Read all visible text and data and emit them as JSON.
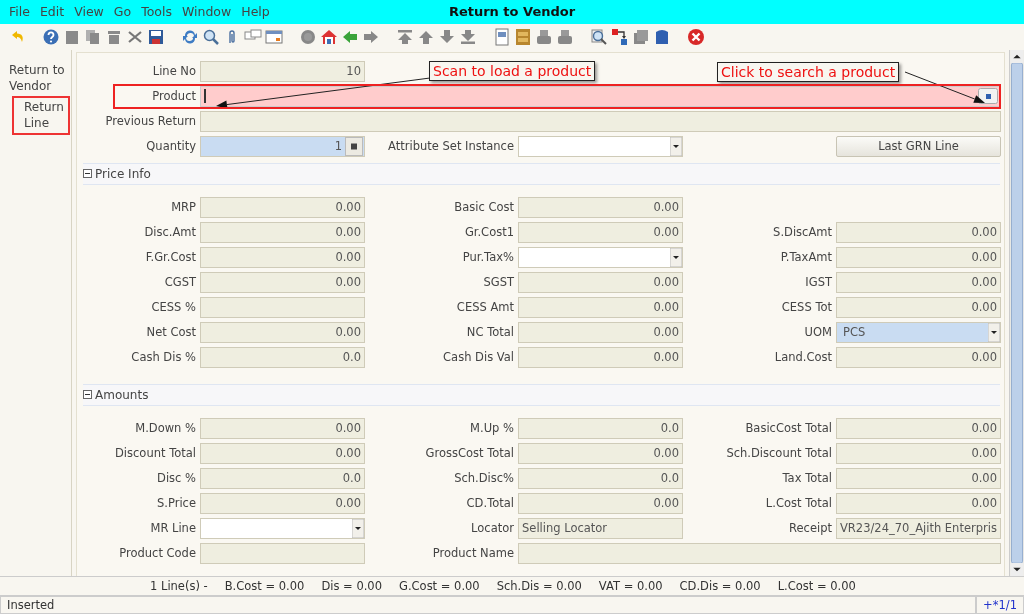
{
  "menu": [
    {
      "label": "File"
    },
    {
      "label": "Edit"
    },
    {
      "label": "View"
    },
    {
      "label": "Go"
    },
    {
      "label": "Tools"
    },
    {
      "label": "Window"
    },
    {
      "label": "Help"
    }
  ],
  "window": {
    "title": "Return to Vendor"
  },
  "tabs": [
    {
      "label": "Return to Vendor",
      "selected": false
    },
    {
      "label": "Return Line",
      "selected": true
    }
  ],
  "header_rows": [
    [
      {
        "label": "Line No",
        "value": "10",
        "kind": "number"
      }
    ],
    [
      {
        "label": "Product",
        "kind": "product",
        "highlighted": true
      }
    ],
    [
      {
        "label": "Previous Return",
        "kind": "wide-text"
      }
    ],
    [
      {
        "label": "Quantity",
        "value": "1",
        "kind": "quantity"
      },
      {
        "label": "Attribute Set Instance",
        "kind": "combo"
      },
      {
        "value": "Last GRN Line",
        "kind": "button"
      }
    ]
  ],
  "sections": [
    {
      "title": "Price Info",
      "expanded": true,
      "rows": [
        [
          {
            "label": "MRP",
            "value": "0.00",
            "kind": "number"
          },
          {
            "label": "Basic Cost",
            "value": "0.00",
            "kind": "number"
          }
        ],
        [
          {
            "label": "Disc.Amt",
            "value": "0.00",
            "kind": "number"
          },
          {
            "label": "Gr.Cost1",
            "value": "0.00",
            "kind": "number"
          },
          {
            "label": "S.DiscAmt",
            "value": "0.00",
            "kind": "number"
          }
        ],
        [
          {
            "label": "F.Gr.Cost",
            "value": "0.00",
            "kind": "number"
          },
          {
            "label": "Pur.Tax%",
            "kind": "combo"
          },
          {
            "label": "P.TaxAmt",
            "value": "0.00",
            "kind": "number"
          }
        ],
        [
          {
            "label": "CGST",
            "value": "0.00",
            "kind": "number"
          },
          {
            "label": "SGST",
            "value": "0.00",
            "kind": "number"
          },
          {
            "label": "IGST",
            "value": "0.00",
            "kind": "number"
          }
        ],
        [
          {
            "label": "CESS %",
            "kind": "number"
          },
          {
            "label": "CESS Amt",
            "value": "0.00",
            "kind": "number"
          },
          {
            "label": "CESS Tot",
            "value": "0.00",
            "kind": "number"
          }
        ],
        [
          {
            "label": "Net Cost",
            "value": "0.00",
            "kind": "number"
          },
          {
            "label": "NC Total",
            "value": "0.00",
            "kind": "number"
          },
          {
            "label": "UOM",
            "value": "PCS",
            "kind": "combo-blue"
          }
        ],
        [
          {
            "label": "Cash Dis %",
            "value": "0.0",
            "kind": "number"
          },
          {
            "label": "Cash Dis Val",
            "value": "0.00",
            "kind": "number"
          },
          {
            "label": "Land.Cost",
            "value": "0.00",
            "kind": "number"
          }
        ]
      ]
    },
    {
      "title": "Amounts",
      "expanded": true,
      "rows": [
        [
          {
            "label": "M.Down %",
            "value": "0.00",
            "kind": "number"
          },
          {
            "label": "M.Up %",
            "value": "0.0",
            "kind": "number"
          },
          {
            "label": "BasicCost Total",
            "value": "0.00",
            "kind": "number"
          }
        ],
        [
          {
            "label": "Discount Total",
            "value": "0.00",
            "kind": "number"
          },
          {
            "label": "GrossCost Total",
            "value": "0.00",
            "kind": "number"
          },
          {
            "label": "Sch.Discount Total",
            "value": "0.00",
            "kind": "number"
          }
        ],
        [
          {
            "label": "Disc %",
            "value": "0.0",
            "kind": "number"
          },
          {
            "label": "Sch.Disc%",
            "value": "0.0",
            "kind": "number"
          },
          {
            "label": "Tax Total",
            "value": "0.00",
            "kind": "number"
          }
        ],
        [
          {
            "label": "S.Price",
            "value": "0.00",
            "kind": "number"
          },
          {
            "label": "CD.Total",
            "value": "0.00",
            "kind": "number"
          },
          {
            "label": "L.Cost Total",
            "value": "0.00",
            "kind": "number"
          }
        ],
        [
          {
            "label": "MR Line",
            "kind": "combo"
          },
          {
            "label": "Locator",
            "value": "Selling Locator",
            "kind": "text"
          },
          {
            "label": "Receipt",
            "value": "VR23/24_70_Ajith Enterpris",
            "kind": "text"
          }
        ],
        [
          {
            "label": "Product Code",
            "kind": "text"
          },
          {
            "label": "Product Name",
            "kind": "wide-text"
          }
        ]
      ]
    }
  ],
  "annotations": [
    {
      "text": "Scan to load a product"
    },
    {
      "text": "Click to search a product"
    }
  ],
  "summary": [
    "1 Line(s) -",
    "B.Cost = 0.00",
    "Dis = 0.00",
    "G.Cost = 0.00",
    "Sch.Dis = 0.00",
    "VAT = 0.00",
    "CD.Dis = 0.00",
    "L.Cost = 0.00"
  ],
  "status_bar": {
    "message": "Inserted",
    "record": "+*1/1"
  }
}
